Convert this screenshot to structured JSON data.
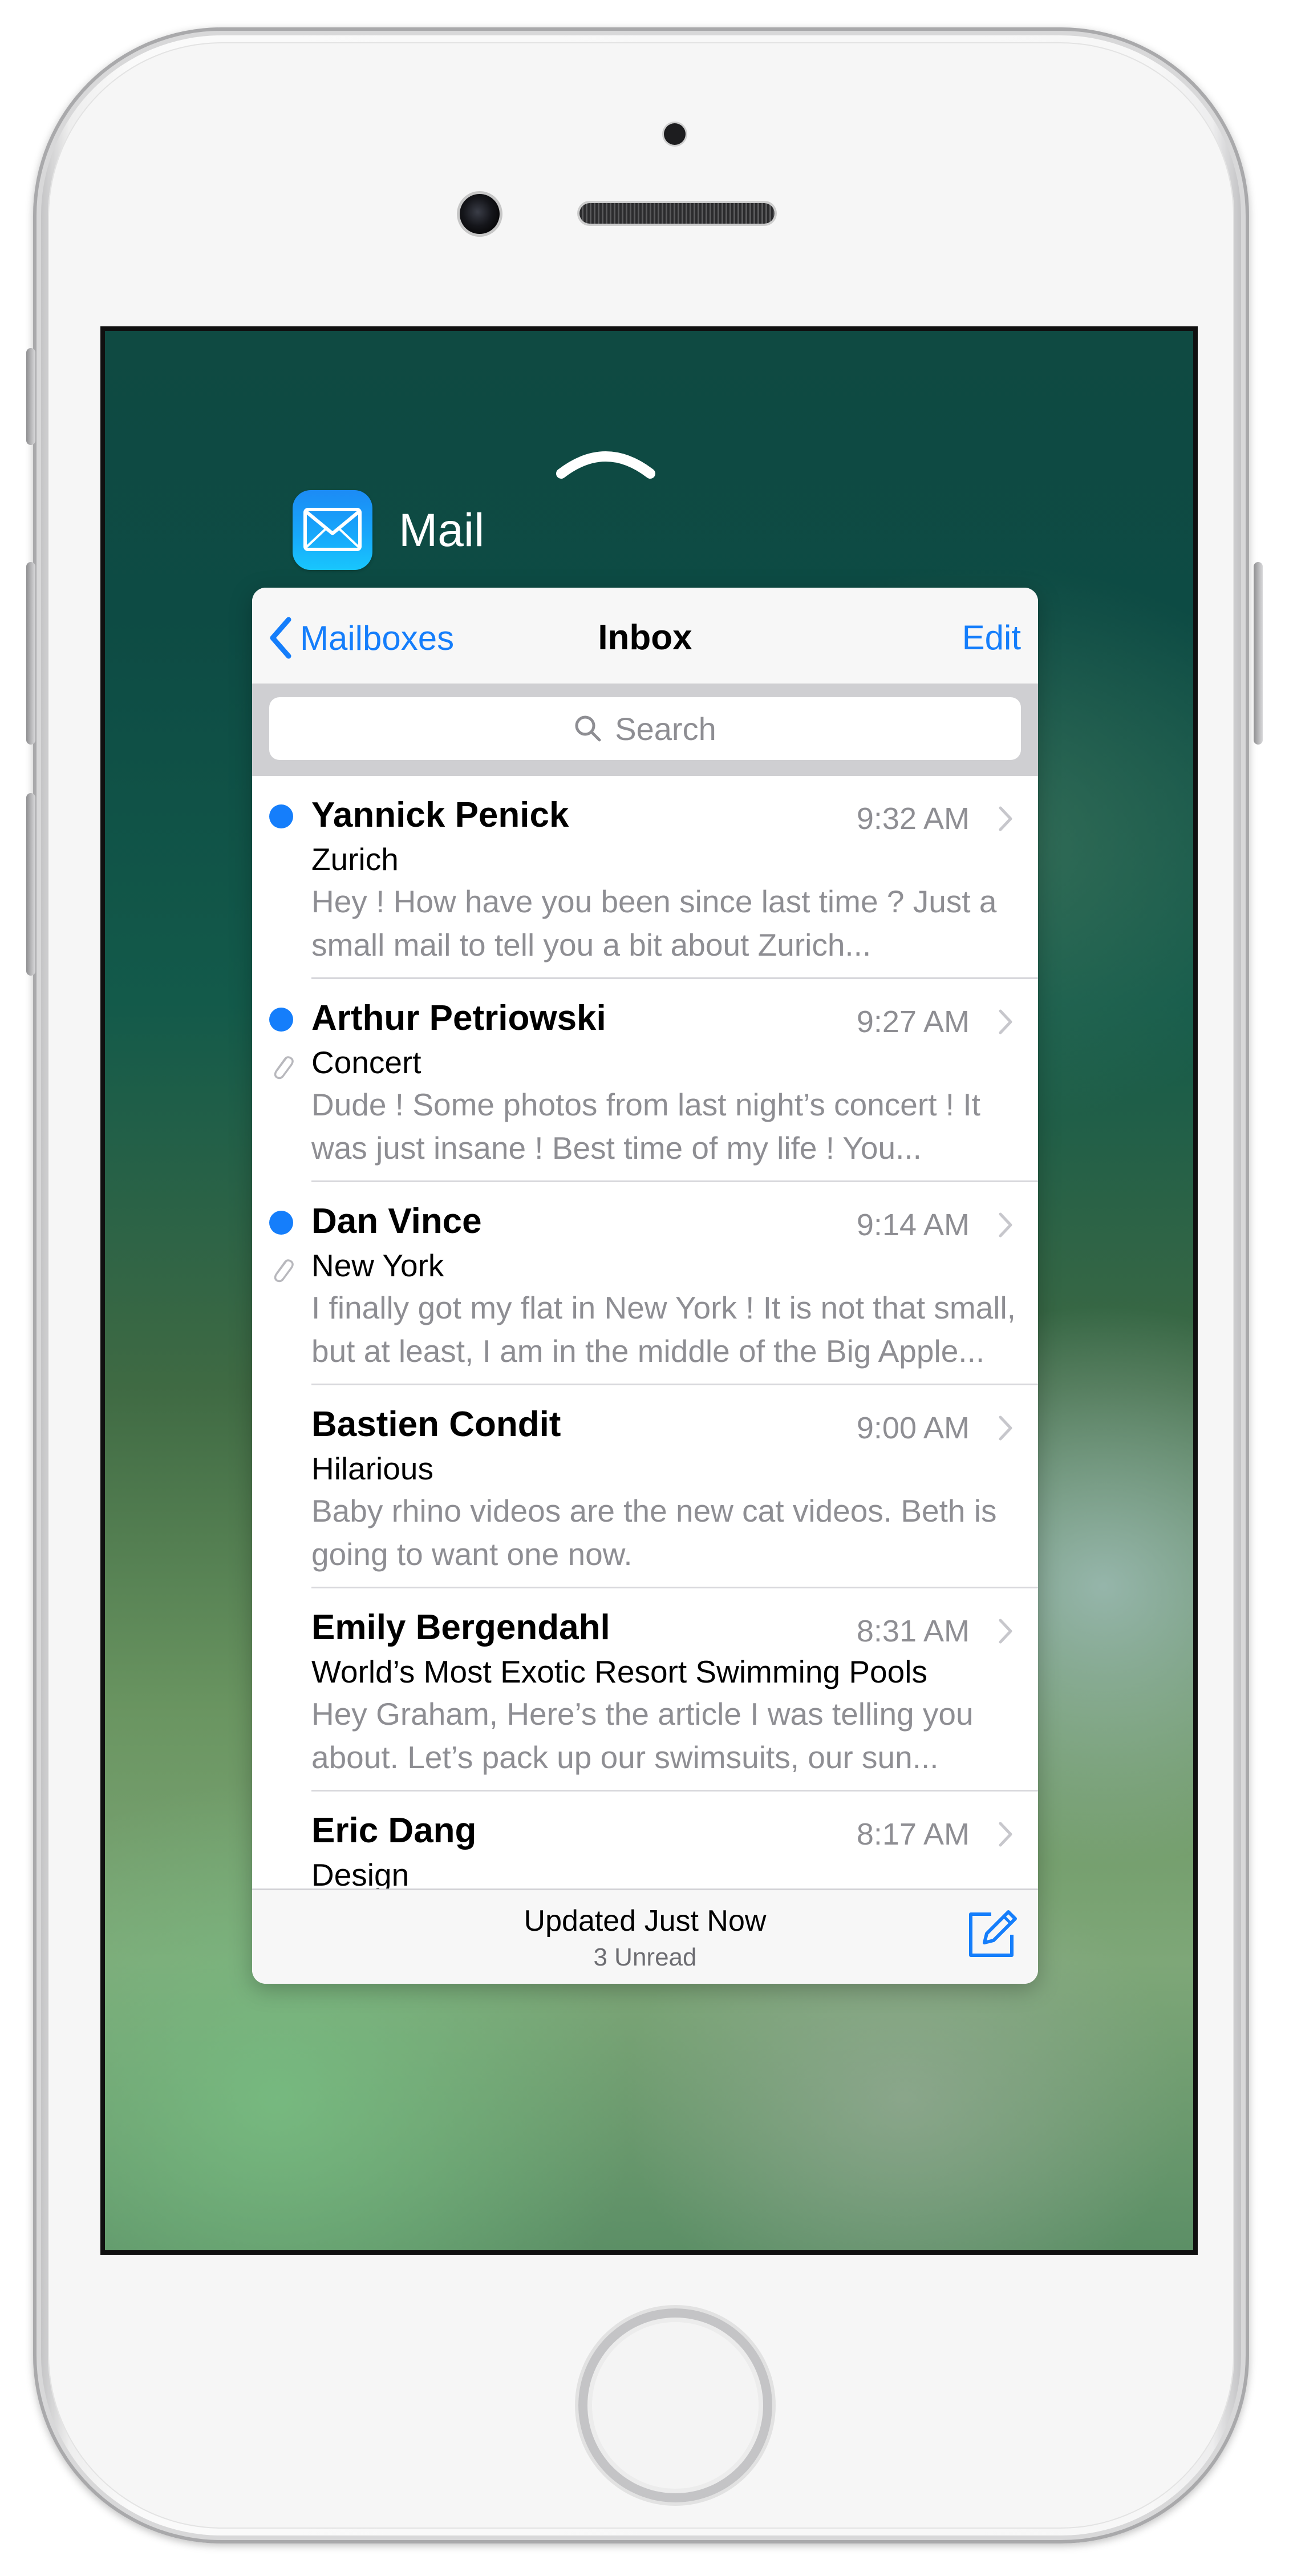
{
  "app": {
    "name": "Mail",
    "icon": "mail-envelope-icon",
    "accent_color": "#157EFB"
  },
  "nav": {
    "back_label": "Mailboxes",
    "title": "Inbox",
    "edit_label": "Edit"
  },
  "search": {
    "placeholder": "Search"
  },
  "messages": [
    {
      "sender": "Yannick Penick",
      "time": "9:32 AM",
      "subject": "Zurich",
      "preview_line1": "Hey ! How have you been since last time ? Just a",
      "preview_line2": "small mail to tell you a bit about Zurich...",
      "unread": true,
      "attachment": false
    },
    {
      "sender": "Arthur Petriowski",
      "time": "9:27 AM",
      "subject": "Concert",
      "preview_line1": "Dude ! Some photos from last night’s concert ! It",
      "preview_line2": "was just insane ! Best time of my life ! You...",
      "unread": true,
      "attachment": true
    },
    {
      "sender": "Dan Vince",
      "time": "9:14 AM",
      "subject": "New York",
      "preview_line1": "I finally got my flat in New York ! It is not that small,",
      "preview_line2": "but at least, I am in the middle of the Big Apple...",
      "unread": true,
      "attachment": true
    },
    {
      "sender": "Bastien Condit",
      "time": "9:00 AM",
      "subject": "Hilarious",
      "preview_line1": "Baby rhino videos are the new cat videos. Beth is",
      "preview_line2": "going to want one now.",
      "unread": false,
      "attachment": false
    },
    {
      "sender": "Emily Bergendahl",
      "time": "8:31 AM",
      "subject": "World’s Most Exotic Resort Swimming Pools",
      "preview_line1": "Hey Graham, Here’s the article I was telling you",
      "preview_line2": "about. Let’s pack up our swimsuits, our sun...",
      "unread": false,
      "attachment": false
    },
    {
      "sender": "Eric Dang",
      "time": "8:17 AM",
      "subject": "Design",
      "preview_line1": "",
      "preview_line2": "",
      "unread": false,
      "attachment": false
    }
  ],
  "toolbar": {
    "status": "Updated Just Now",
    "unread_count": "3 Unread",
    "compose_icon": "compose-icon"
  }
}
